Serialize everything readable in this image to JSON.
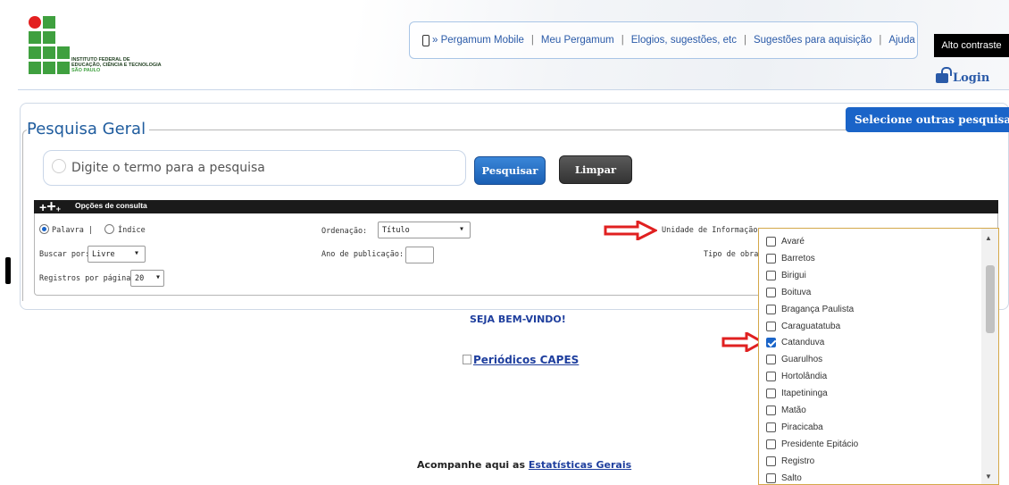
{
  "header": {
    "logo_text": [
      "INSTITUTO FEDERAL DE",
      "EDUCAÇÃO, CIÊNCIA E TECNOLOGIA",
      "SÃO PAULO"
    ],
    "nav": [
      {
        "label": "» Pergamum Mobile",
        "icon": "phone-icon"
      },
      {
        "label": "Meu Pergamum"
      },
      {
        "label": "Elogios, sugestões, etc"
      },
      {
        "label": "Sugestões para aquisição"
      },
      {
        "label": "Ajuda"
      }
    ],
    "alto_contraste": "Alto contraste",
    "login": "Login"
  },
  "search": {
    "title": "Pesquisa Geral",
    "outras_pesquisas": "Selecione outras pesquisas",
    "placeholder": "Digite o termo para a pesquisa",
    "pesquisar": "Pesquisar",
    "limpar": "Limpar"
  },
  "options": {
    "bar_label": "Opções de consulta",
    "palavra": "Palavra |",
    "indice": "Índice",
    "ordenacao_label": "Ordenação:",
    "ordenacao_value": "Título",
    "unidade_label": "Unidade de Informação:",
    "buscar_por_label": "Buscar por:",
    "buscar_por_value": "Livre",
    "ano_label": "Ano de publicação:",
    "tipo_obra_label": "Tipo de obra:",
    "registros_label": "Registros por página:",
    "registros_value": "20"
  },
  "unidades": [
    {
      "label": "Avaré",
      "checked": false
    },
    {
      "label": "Barretos",
      "checked": false
    },
    {
      "label": "Birigui",
      "checked": false
    },
    {
      "label": "Boituva",
      "checked": false
    },
    {
      "label": "Bragança Paulista",
      "checked": false
    },
    {
      "label": "Caraguatatuba",
      "checked": false
    },
    {
      "label": "Catanduva",
      "checked": true
    },
    {
      "label": "Guarulhos",
      "checked": false
    },
    {
      "label": "Hortolândia",
      "checked": false
    },
    {
      "label": "Itapetininga",
      "checked": false
    },
    {
      "label": "Matão",
      "checked": false
    },
    {
      "label": "Piracicaba",
      "checked": false
    },
    {
      "label": "Presidente Epitácio",
      "checked": false
    },
    {
      "label": "Registro",
      "checked": false
    },
    {
      "label": "Salto",
      "checked": false
    }
  ],
  "main": {
    "welcome": "SEJA BEM-VINDO!",
    "capes": "Periódicos CAPES",
    "acompanhe": "Acompanhe aqui as",
    "estatisticas": "Estatísticas Gerais"
  },
  "colors": {
    "accent": "#1a64c8",
    "title": "#1f5c9e",
    "arrow": "#e02020",
    "logo_green": "#3fa03f",
    "logo_red": "#e32020"
  }
}
